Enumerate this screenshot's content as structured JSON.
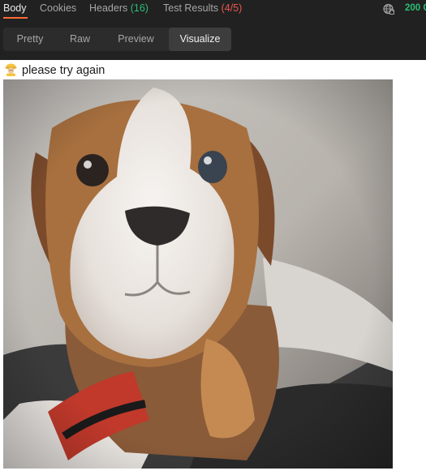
{
  "tabs": {
    "body": "Body",
    "cookies": "Cookies",
    "headers": "Headers",
    "headers_count": "(16)",
    "tests": "Test Results",
    "tests_count": "(4/5)"
  },
  "status": {
    "code": "200 O",
    "globe_icon": "globe-icon"
  },
  "view_modes": {
    "pretty": "Pretty",
    "raw": "Raw",
    "preview": "Preview",
    "visualize": "Visualize",
    "selected": "Visualize"
  },
  "visualizer": {
    "emoji_icon": "construction-worker-emoji",
    "message": "please try again",
    "image": "bulldog-puppy-photo"
  },
  "colors": {
    "accent": "#ff6c37",
    "success": "#2dbe78",
    "error": "#e9584b"
  }
}
